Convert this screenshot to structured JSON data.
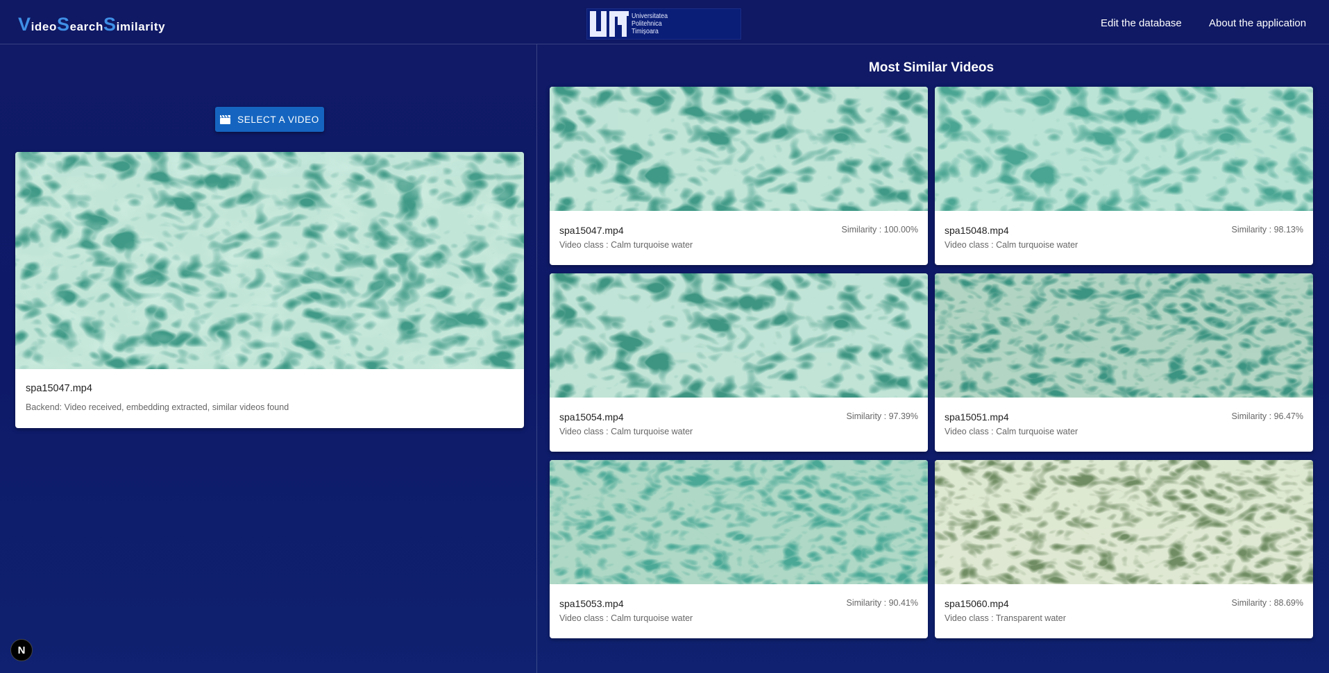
{
  "header": {
    "brand": {
      "parts": [
        {
          "cap": "V",
          "rest": "ideo"
        },
        {
          "cap": "S",
          "rest": "earch"
        },
        {
          "cap": "S",
          "rest": "imilarity"
        }
      ]
    },
    "logo": {
      "mark_text": "UPT",
      "lines": [
        "Universitatea",
        "Politehnica",
        "Timișoara"
      ]
    },
    "nav": {
      "edit_label": "Edit the database",
      "about_label": "About the application"
    }
  },
  "upload": {
    "button_label": "SELECT A VIDEO",
    "button_icon": "clapperboard-icon",
    "selected": {
      "filename": "spa15047.mp4",
      "status": "Backend: Video received, embedding extracted, similar videos found"
    }
  },
  "results": {
    "title": "Most Similar Videos",
    "items": [
      {
        "filename": "spa15047.mp4",
        "similarity": "Similarity : 100.00%",
        "video_class": "Video class : Calm turquoise water"
      },
      {
        "filename": "spa15048.mp4",
        "similarity": "Similarity : 98.13%",
        "video_class": "Video class : Calm turquoise water"
      },
      {
        "filename": "spa15054.mp4",
        "similarity": "Similarity : 97.39%",
        "video_class": "Video class : Calm turquoise water"
      },
      {
        "filename": "spa15051.mp4",
        "similarity": "Similarity : 96.47%",
        "video_class": "Video class : Calm turquoise water"
      },
      {
        "filename": "spa15053.mp4",
        "similarity": "Similarity : 90.41%",
        "video_class": "Video class : Calm turquoise water"
      },
      {
        "filename": "spa15060.mp4",
        "similarity": "Similarity : 88.69%",
        "video_class": "Video class : Transparent water"
      }
    ]
  },
  "dev_badge": {
    "label": "N"
  },
  "colors": {
    "background": "#0f1a66",
    "accent": "#3f8fe6",
    "button": "#1565c0",
    "water_turquoise": "#4aa592",
    "water_transparent": "#7f9a6e"
  }
}
